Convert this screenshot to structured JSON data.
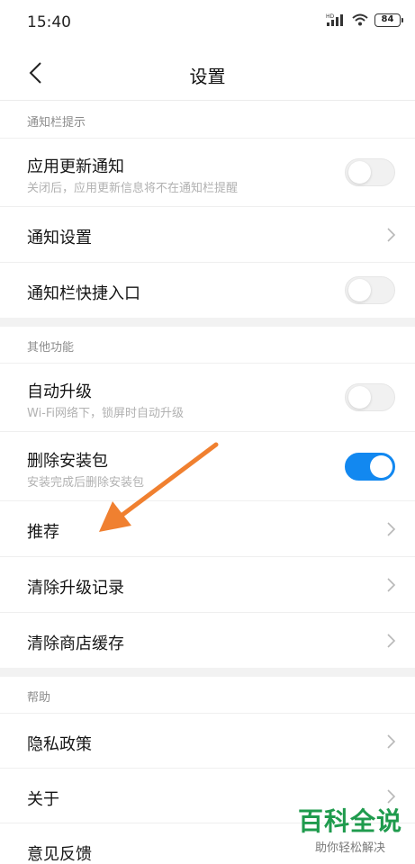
{
  "status_bar": {
    "time": "15:40",
    "battery": "84",
    "hd_label": "HD"
  },
  "header": {
    "title": "设置"
  },
  "sections": [
    {
      "title": "通知栏提示"
    },
    {
      "title": "其他功能"
    },
    {
      "title": "帮助"
    }
  ],
  "rows": {
    "app_update_notify": {
      "title": "应用更新通知",
      "subtitle": "关闭后，应用更新信息将不在通知栏提醒",
      "toggle_on": false
    },
    "notify_settings": {
      "title": "通知设置"
    },
    "notify_shortcut": {
      "title": "通知栏快捷入口",
      "toggle_on": false
    },
    "auto_upgrade": {
      "title": "自动升级",
      "subtitle": "Wi-Fi网络下，锁屏时自动升级",
      "toggle_on": false
    },
    "delete_package": {
      "title": "删除安装包",
      "subtitle": "安装完成后删除安装包",
      "toggle_on": true
    },
    "recommend": {
      "title": "推荐"
    },
    "clear_upgrade": {
      "title": "清除升级记录"
    },
    "clear_cache": {
      "title": "清除商店缓存"
    },
    "privacy": {
      "title": "隐私政策"
    },
    "about": {
      "title": "关于"
    },
    "feedback": {
      "title": "意见反馈"
    }
  },
  "watermark": {
    "title": "百科全说",
    "subtitle": "助你轻松解决"
  },
  "colors": {
    "toggle_on": "#1288f0",
    "arrow": "#f08030",
    "watermark": "#1f9b4d"
  }
}
